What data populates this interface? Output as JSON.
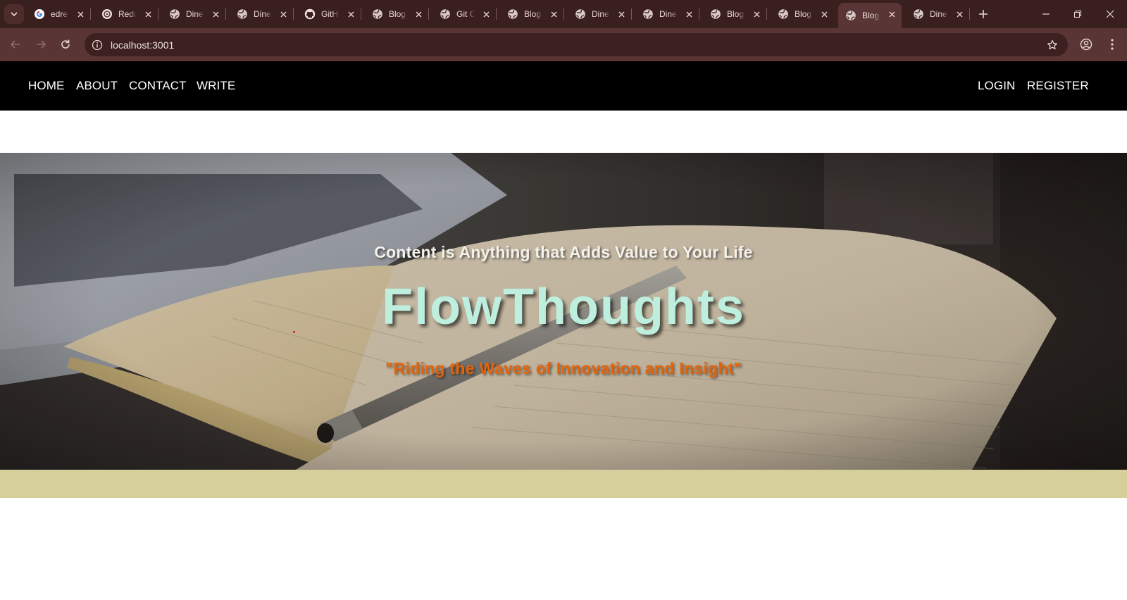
{
  "browser": {
    "tabs": [
      {
        "title": "edre",
        "favicon": "google-icon",
        "active": false
      },
      {
        "title": "Redu",
        "favicon": "redux-icon",
        "active": false
      },
      {
        "title": "Dine",
        "favicon": "globe-icon",
        "active": false
      },
      {
        "title": "Dine",
        "favicon": "globe-icon",
        "active": false
      },
      {
        "title": "GitH",
        "favicon": "github-icon",
        "active": false
      },
      {
        "title": "Blog",
        "favicon": "globe-icon",
        "active": false
      },
      {
        "title": "Git C",
        "favicon": "globe-icon",
        "active": false
      },
      {
        "title": "Blog",
        "favicon": "globe-icon",
        "active": false
      },
      {
        "title": "Dine",
        "favicon": "globe-icon",
        "active": false
      },
      {
        "title": "Dine",
        "favicon": "globe-icon",
        "active": false
      },
      {
        "title": "Blog",
        "favicon": "globe-icon",
        "active": false
      },
      {
        "title": "Blog",
        "favicon": "globe-icon",
        "active": false
      },
      {
        "title": "Blog",
        "favicon": "globe-icon",
        "active": true
      },
      {
        "title": "Dine",
        "favicon": "globe-icon",
        "active": false
      }
    ],
    "url": "localhost:3001",
    "theme_colors": {
      "tabstrip": "#3a1f1f",
      "toolbar": "#5a3535",
      "omnibox": "#3d2020"
    }
  },
  "site": {
    "nav_left": [
      "HOME",
      "ABOUT",
      "CONTACT",
      "WRITE"
    ],
    "nav_right": [
      "LOGIN",
      "REGISTER"
    ],
    "hero": {
      "subtitle": "Content is Anything that Adds Value to Your Life",
      "title": "FlowThoughts",
      "tagline": "\"Riding the Waves of Innovation and Insight\""
    },
    "colors": {
      "nav_bg": "#000000",
      "title": "#bdeede",
      "tagline": "#e4640c",
      "band": "#d7cf9b"
    }
  }
}
